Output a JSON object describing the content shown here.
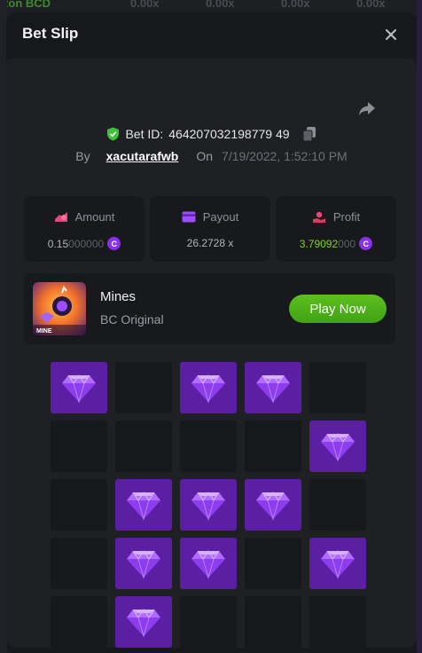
{
  "background": {
    "strip_texts": [
      "Ron BCD",
      "0.00x",
      "0.00x",
      "0.00x",
      "0.00x"
    ]
  },
  "modal": {
    "title": "Bet Slip",
    "close_icon": "close-icon",
    "share_icon": "share-icon"
  },
  "bet": {
    "id_label": "Bet ID:",
    "id": "464207032198779 49",
    "by_label": "By",
    "username": "xacutarafwb",
    "on_label": "On",
    "date": "7/19/2022, 1:52:10 PM"
  },
  "stats": {
    "amount": {
      "label": "Amount",
      "value_main": "0.15",
      "value_dim": "000000",
      "icon": "amount-icon"
    },
    "payout": {
      "label": "Payout",
      "value": "26.2728 x",
      "icon": "card-icon"
    },
    "profit": {
      "label": "Profit",
      "value_main": "3.79092",
      "value_dim": "000",
      "icon": "profit-icon"
    },
    "coin_symbol": "C"
  },
  "game": {
    "name": "Mines",
    "subtitle": "BC Original",
    "play_label": "Play Now",
    "thumb_label": "MINE"
  },
  "grid": {
    "columns": 5,
    "rows": 5,
    "cells": [
      1,
      0,
      1,
      1,
      0,
      0,
      0,
      0,
      0,
      1,
      0,
      1,
      1,
      1,
      0,
      0,
      1,
      1,
      0,
      1,
      0,
      1,
      0,
      0,
      0
    ]
  },
  "colors": {
    "gem_tile": "#5a1fa3",
    "empty_tile": "#17181b",
    "play_button": "#4fb21a",
    "profit_green": "#7ed321",
    "coin": "#8b2ef0"
  }
}
